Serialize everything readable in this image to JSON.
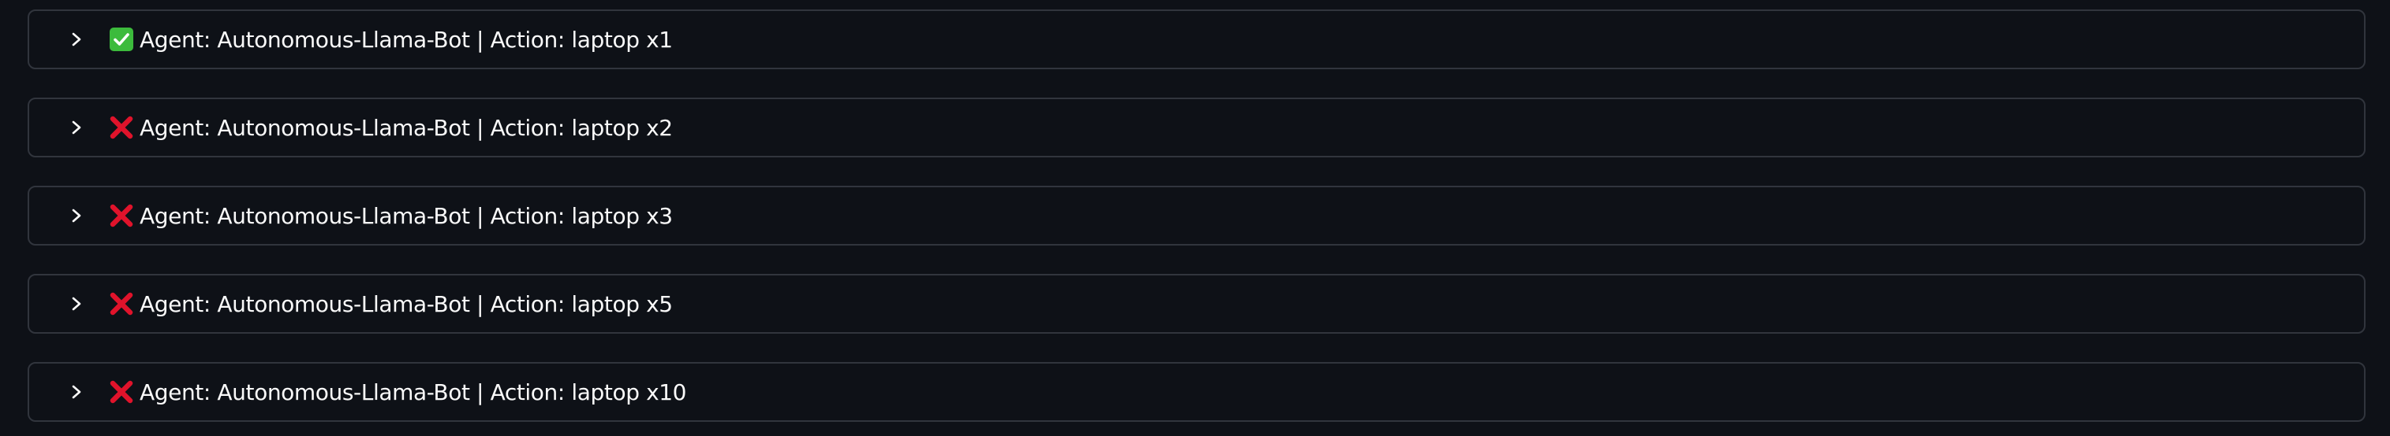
{
  "expanders": [
    {
      "status": "success",
      "status_icon": "check-mark-icon",
      "label": "Agent: Autonomous-Llama-Bot | Action: laptop x1"
    },
    {
      "status": "failure",
      "status_icon": "cross-mark-icon",
      "label": "Agent: Autonomous-Llama-Bot | Action: laptop x2"
    },
    {
      "status": "failure",
      "status_icon": "cross-mark-icon",
      "label": "Agent: Autonomous-Llama-Bot | Action: laptop x3"
    },
    {
      "status": "failure",
      "status_icon": "cross-mark-icon",
      "label": "Agent: Autonomous-Llama-Bot | Action: laptop x5"
    },
    {
      "status": "failure",
      "status_icon": "cross-mark-icon",
      "label": "Agent: Autonomous-Llama-Bot | Action: laptop x10"
    }
  ],
  "colors": {
    "background": "#0e1117",
    "border": "#31353d",
    "text": "#fafafa",
    "success": "#3cbb3c",
    "failure": "#e0132b"
  }
}
